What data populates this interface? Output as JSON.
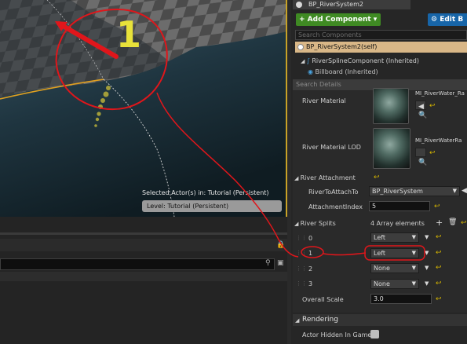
{
  "tab": {
    "title": "BP_RiverSystem2"
  },
  "toolbar": {
    "add_component": "+ Add Component ▾",
    "edit_blueprint": "Edit B"
  },
  "components": {
    "search_placeholder": "Search Components",
    "self_item": "BP_RiverSystem2(self)",
    "spline_item": "RiverSplineComponent (Inherited)",
    "billboard_item": "Billboard (Inherited)"
  },
  "details": {
    "search_placeholder": "Search Details",
    "river_material_label": "River Material",
    "river_material_value": "MI_RiverWater_Ra",
    "river_material_lod_label": "River Material LOD",
    "river_material_lod_value": "MI_RiverWaterRa",
    "river_attachment_label": "River Attachment",
    "river_to_attach_label": "RiverToAttachTo",
    "river_to_attach_value": "BP_RiverSystem",
    "attachment_index_label": "AttachmentIndex",
    "attachment_index_value": "5",
    "river_splits_label": "River Splits",
    "river_splits_count": "4 Array elements",
    "splits": [
      {
        "index": "0",
        "value": "Left"
      },
      {
        "index": "1",
        "value": "Left"
      },
      {
        "index": "2",
        "value": "None"
      },
      {
        "index": "3",
        "value": "None"
      }
    ],
    "overall_scale_label": "Overall Scale",
    "overall_scale_value": "3.0",
    "rendering_section": "Rendering",
    "actor_hidden_label": "Actor Hidden In Game"
  },
  "viewport": {
    "annotation_number": "1",
    "selected_actor_text": "Selected Actor(s) in:  Tutorial (Persistent)",
    "level_text": "Level:  Tutorial (Persistent)"
  },
  "colors": {
    "annotation_red": "#e0161b",
    "annotation_yellow": "#e8e23a",
    "add_green": "#3f8a23",
    "edit_blue": "#1765a8",
    "selection_tan": "#d9b787"
  }
}
